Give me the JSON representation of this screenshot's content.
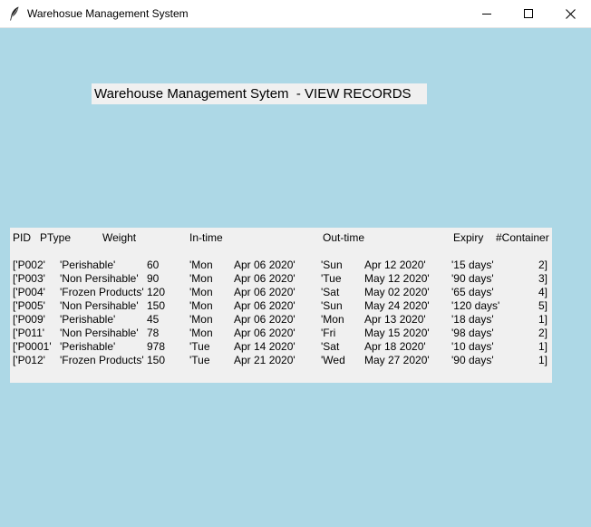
{
  "window": {
    "title": "Warehosue Management System"
  },
  "heading": "Warehouse Management Sytem  - VIEW RECORDS",
  "table": {
    "headers": [
      "PID",
      "PType",
      "Weight",
      "In-time",
      "Out-time",
      "Expiry",
      "#Container"
    ],
    "rows": [
      [
        "['P002'",
        "'Perishable'",
        "60",
        "'Mon",
        "Apr 06 2020'",
        "'Sun",
        "Apr 12 2020'",
        "'15 days'",
        "2]"
      ],
      [
        "['P003'",
        "'Non Persihable'",
        "90",
        "'Mon",
        "Apr 06 2020'",
        "'Tue",
        "May 12 2020'",
        "'90 days'",
        "3]"
      ],
      [
        "['P004'",
        "'Frozen Products'",
        "120",
        "'Mon",
        "Apr 06 2020'",
        "'Sat",
        "May 02 2020'",
        "'65 days'",
        "4]"
      ],
      [
        "['P005'",
        "'Non Persihable'",
        "150",
        "'Mon",
        "Apr 06 2020'",
        "'Sun",
        "May 24 2020'",
        "'120 days'",
        "5]"
      ],
      [
        "['P009'",
        "'Perishable'",
        "45",
        "'Mon",
        "Apr 06 2020'",
        "'Mon",
        "Apr 13 2020'",
        "'18 days'",
        "1]"
      ],
      [
        "['P011'",
        "'Non Persihable'",
        "78",
        "'Mon",
        "Apr 06 2020'",
        "'Fri",
        "May 15 2020'",
        "'98 days'",
        "2]"
      ],
      [
        "['P0001'",
        "'Perishable'",
        "978",
        "'Tue",
        "Apr 14 2020'",
        "'Sat",
        "Apr 18 2020'",
        "'10 days'",
        "1]"
      ],
      [
        "['P012'",
        "'Frozen Products'",
        "150",
        "'Tue",
        "Apr 21 2020'",
        "'Wed",
        "May 27 2020'",
        "'90 days'",
        "1]"
      ]
    ]
  }
}
